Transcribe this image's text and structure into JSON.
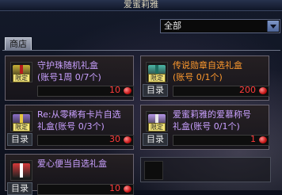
{
  "window": {
    "title": "爱蜜莉雅"
  },
  "filter": {
    "selected": "全部"
  },
  "tabs": [
    {
      "label": "商店"
    }
  ],
  "items": [
    {
      "name": "守护珠随机礼盒",
      "detail": "(账号1周 0/7个)",
      "badge": "限定",
      "button": "",
      "price": "10",
      "name_color": "#c9a0ff",
      "detail_color": "#c9a0ff",
      "icon": "gift-box-icon",
      "icon_color": "#c9b236"
    },
    {
      "name": "传说勋章自选礼盒",
      "detail": "(账号 0/1个)",
      "badge": "限定",
      "button": "目录",
      "price": "200",
      "name_color": "#ff9a2e",
      "detail_color": "#ff9a2e",
      "icon": "teal-gift-box-icon",
      "icon_color": "#4bb8a7"
    },
    {
      "name": "Re:从零稀有卡片自选",
      "detail": "礼盒(账号 0/3个)",
      "badge": "限定",
      "button": "目录",
      "price": "30",
      "name_color": "#c9a0ff",
      "detail_color": "#c9a0ff",
      "icon": "card-gift-box-icon",
      "icon_color": "#8b6fc7"
    },
    {
      "name": "爱蜜莉雅的爱慕称号",
      "detail": "礼盒(账号 0/1个)",
      "badge": "限定",
      "button": "目录",
      "price": "1",
      "name_color": "#c9a0ff",
      "detail_color": "#c9a0ff",
      "icon": "purple-gift-box-icon",
      "icon_color": "#b797e8"
    },
    {
      "name": "爱心便当自选礼盒",
      "detail": "",
      "badge": "",
      "button": "目录",
      "price": "10",
      "name_color": "#c9a0ff",
      "detail_color": "#c9a0ff",
      "icon": "red-gift-box-icon",
      "icon_color": "#d63a3a"
    }
  ]
}
